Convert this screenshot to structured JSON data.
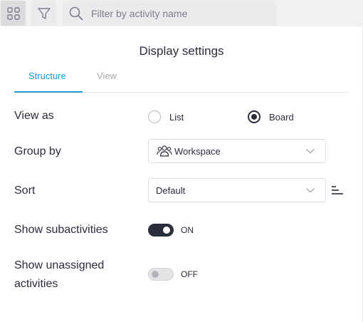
{
  "toolbar": {
    "grid_icon": "grid-icon",
    "filter_icon": "filter-icon",
    "search_icon": "search-icon",
    "search_placeholder": "Filter by activity name"
  },
  "panel": {
    "title": "Display settings",
    "tabs": [
      {
        "label": "Structure",
        "active": true
      },
      {
        "label": "View",
        "active": false
      }
    ],
    "view_as": {
      "label": "View as",
      "options": [
        {
          "label": "List",
          "selected": false
        },
        {
          "label": "Board",
          "selected": true
        }
      ]
    },
    "group_by": {
      "label": "Group by",
      "value": "Workspace",
      "icon": "people-icon"
    },
    "sort": {
      "label": "Sort",
      "value": "Default",
      "order_icon": "sort-order-icon"
    },
    "show_subactivities": {
      "label": "Show subactivities",
      "state": "ON",
      "on": true
    },
    "show_unassigned": {
      "label_line1": "Show unassigned",
      "label_line2": "activities",
      "state": "OFF",
      "on": false
    }
  },
  "colors": {
    "accent": "#1a9ad6",
    "dark": "#2a2d3b",
    "muted": "#a8aab0"
  }
}
